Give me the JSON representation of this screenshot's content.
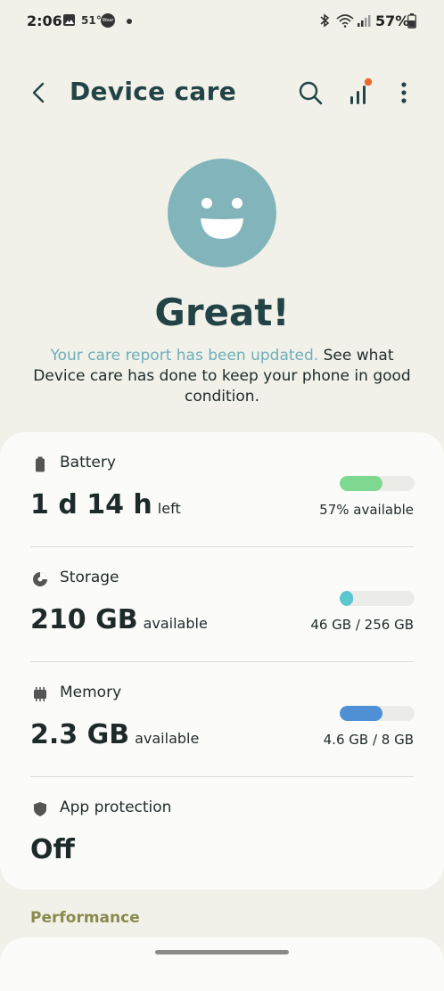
{
  "status_bar": {
    "time": "2:06",
    "temperature": "51°",
    "wear_label": "Wear",
    "battery_percent": "57%"
  },
  "app_bar": {
    "title": "Device care",
    "back_icon": "back-arrow-icon",
    "search_icon": "search-icon",
    "stats_icon": "signal-bars-icon",
    "more_icon": "more-vertical-icon"
  },
  "hero": {
    "face_icon": "smiley-face-icon",
    "face_color": "#82b4bb",
    "headline": "Great!",
    "report_link": "Your care report has been updated.",
    "report_text": " See what Device care has done to keep your phone in good condition."
  },
  "sections": {
    "battery": {
      "label": "Battery",
      "value": "1 d 14 h",
      "unit": "left",
      "detail": "57% available",
      "level": 0.57,
      "color": "#7fd88f"
    },
    "storage": {
      "label": "Storage",
      "value": "210 GB",
      "unit": "available",
      "detail": "46 GB / 256 GB",
      "level": 0.18,
      "color": "#5cc6ce"
    },
    "memory": {
      "label": "Memory",
      "value": "2.3 GB",
      "unit": "available",
      "detail": "4.6 GB / 8 GB",
      "level": 0.57,
      "color": "#4f8fd6"
    },
    "app_protection": {
      "label": "App protection",
      "value": "Off"
    }
  },
  "performance_label": "Performance"
}
